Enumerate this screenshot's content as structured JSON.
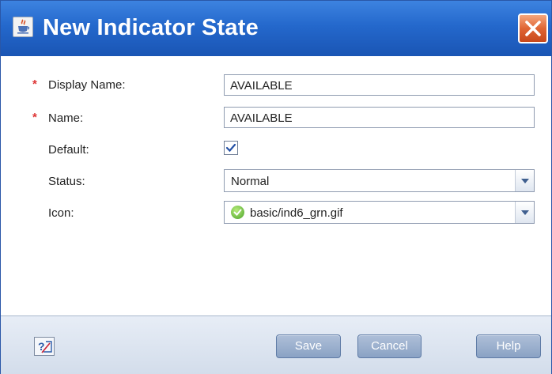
{
  "dialog": {
    "title": "New Indicator State",
    "title_icon": "java-cup-icon",
    "close_icon": "close-icon"
  },
  "form": {
    "required_marker": "*",
    "display_name": {
      "label": "Display Name:",
      "value": "AVAILABLE",
      "required": true
    },
    "name": {
      "label": "Name:",
      "value": "AVAILABLE",
      "required": true
    },
    "default": {
      "label": "Default:",
      "checked": true
    },
    "status": {
      "label": "Status:",
      "value": "Normal"
    },
    "icon": {
      "label": "Icon:",
      "value": "basic/ind6_grn.gif",
      "value_icon": "green-check-icon"
    }
  },
  "footer": {
    "help_icon": "context-help-icon",
    "save_label": "Save",
    "cancel_label": "Cancel",
    "help_label": "Help"
  },
  "colors": {
    "title_bar": "#2468cc",
    "close_button": "#e06534",
    "required_marker": "#dd3333",
    "button": "#8aa2c4",
    "footer": "#dbe3ef"
  }
}
